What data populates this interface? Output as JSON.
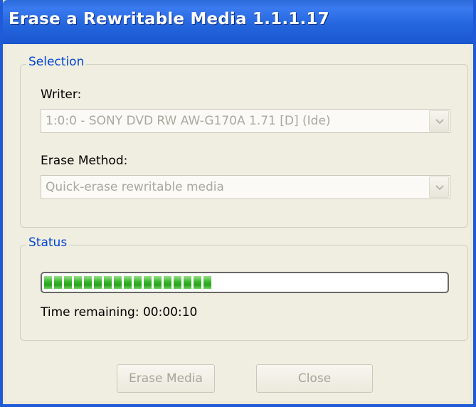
{
  "window": {
    "title": "Erase a Rewritable Media 1.1.1.17"
  },
  "selection": {
    "legend": "Selection",
    "writer_label": "Writer:",
    "writer_value": "1:0:0 - SONY DVD RW AW-G170A 1.71 [D] (Ide)",
    "method_label": "Erase Method:",
    "method_value": "Quick-erase rewritable media"
  },
  "status": {
    "legend": "Status",
    "progress_fraction": 0.44,
    "time_remaining": "Time remaining: 00:00:10"
  },
  "buttons": {
    "erase": "Erase Media",
    "close": "Close"
  },
  "colors": {
    "title_bar": "#2466de",
    "group_legend": "#0046d5",
    "progress_fill": "#37b52a",
    "disabled_text": "#a9a9a0"
  }
}
